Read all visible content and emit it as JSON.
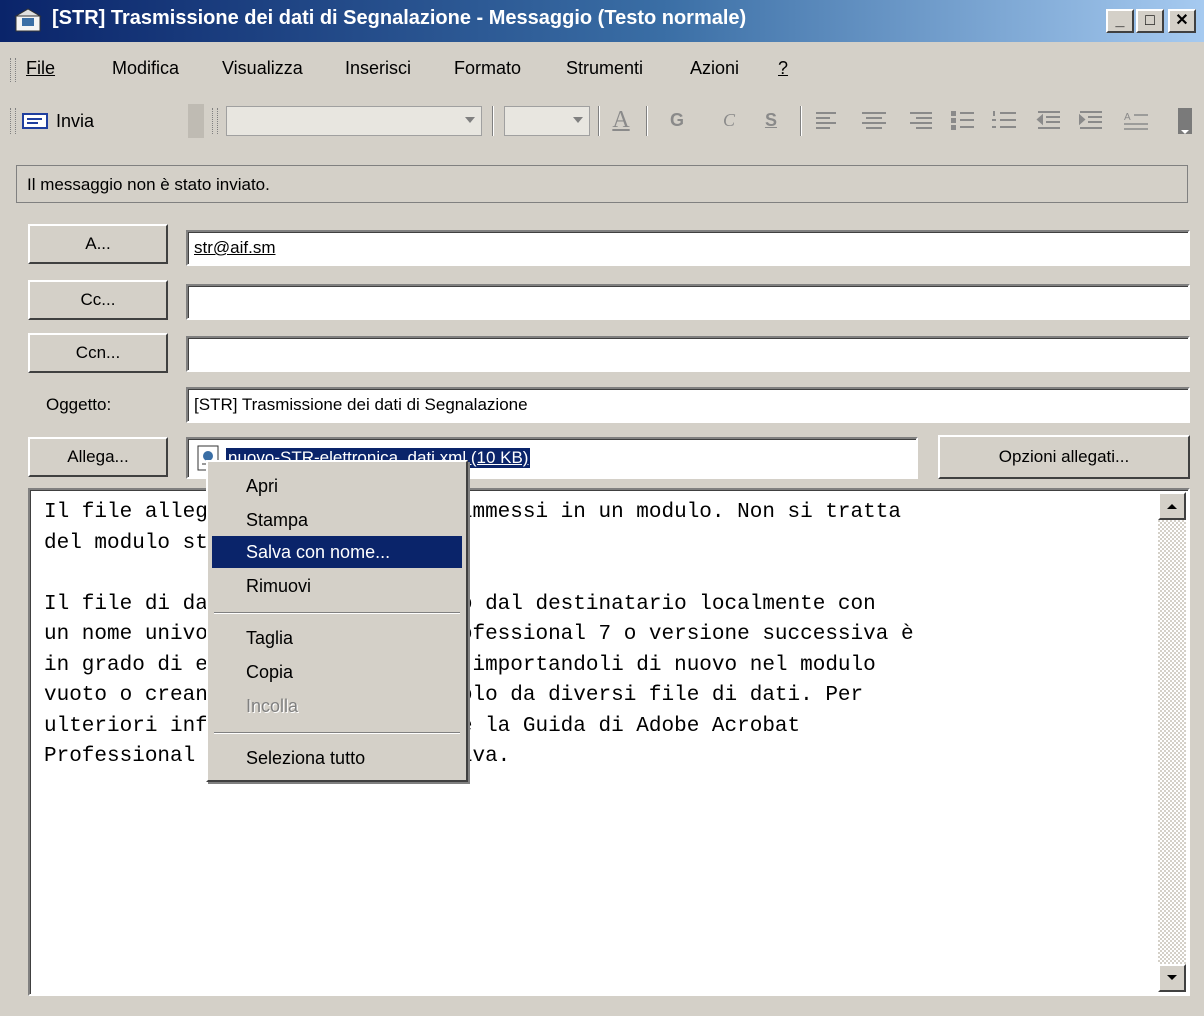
{
  "window": {
    "title": "[STR] Trasmissione dei dati di Segnalazione  - Messaggio (Testo normale)",
    "controls": {
      "minimize": "_",
      "maximize": "□",
      "close": "✕"
    }
  },
  "menu": [
    {
      "label": "File"
    },
    {
      "label": "Modifica"
    },
    {
      "label": "Visualizza"
    },
    {
      "label": "Inserisci"
    },
    {
      "label": "Formato"
    },
    {
      "label": "Strumenti"
    },
    {
      "label": "Azioni"
    },
    {
      "label": "?"
    }
  ],
  "toolbar": {
    "send_label": "Invia",
    "font_combo": "",
    "size_combo": "",
    "format_icons": [
      "font-color-icon",
      "bold-icon",
      "italic-icon",
      "underline-icon",
      "align-left-icon",
      "align-center-icon",
      "align-right-icon",
      "bullets-icon",
      "numbering-icon",
      "decrease-indent-icon",
      "increase-indent-icon",
      "style-icon"
    ],
    "bold": "G",
    "italic": "C",
    "underline": "S",
    "font_color": "A"
  },
  "status": "Il messaggio non è stato inviato.",
  "fields": {
    "to_button": "A...",
    "to_value": "str@aif.sm",
    "cc_button": "Cc...",
    "cc_value": "",
    "bcc_button": "Ccn...",
    "bcc_value": "",
    "subject_label": "Oggetto:",
    "subject_value": "[STR] Trasmissione dei dati di Segnalazione",
    "attach_button": "Allega...",
    "attachment_value": "nuovo-STR-elettronica_dati.xml (10 KB)",
    "attach_options_button": "Opzioni allegati..."
  },
  "body_lines": [
    "Il file allegato contiene i dati immessi in un modulo. Non si tratta",
    "del modulo stesso.",
    "",
    "Il file di dati può essere salvato dal destinatario localmente con",
    "un nome univoco. Adobe Acrobat Professional 7 o versione successiva è",
    "in grado di elaborare questi dati importandoli di nuovo nel modulo",
    "vuoto o creando un foglio di calcolo da diversi file di dati. Per",
    "ulteriori informazioni, consultare la Guida di Adobe Acrobat",
    "Professional 7 o versione successiva."
  ],
  "context_menu": {
    "items": [
      {
        "label": "Apri",
        "state": "normal"
      },
      {
        "label": "Stampa",
        "state": "normal"
      },
      {
        "label": "Salva con nome...",
        "state": "selected"
      },
      {
        "label": "Rimuovi",
        "state": "normal"
      },
      {
        "label": "Taglia",
        "state": "normal"
      },
      {
        "label": "Copia",
        "state": "normal"
      },
      {
        "label": "Incolla",
        "state": "disabled"
      },
      {
        "label": "Seleziona tutto",
        "state": "normal"
      }
    ]
  },
  "colors": {
    "titlebar_start": "#0a246a",
    "titlebar_end": "#a6caf0",
    "selection": "#0a246a",
    "face": "#d4d0c8"
  }
}
